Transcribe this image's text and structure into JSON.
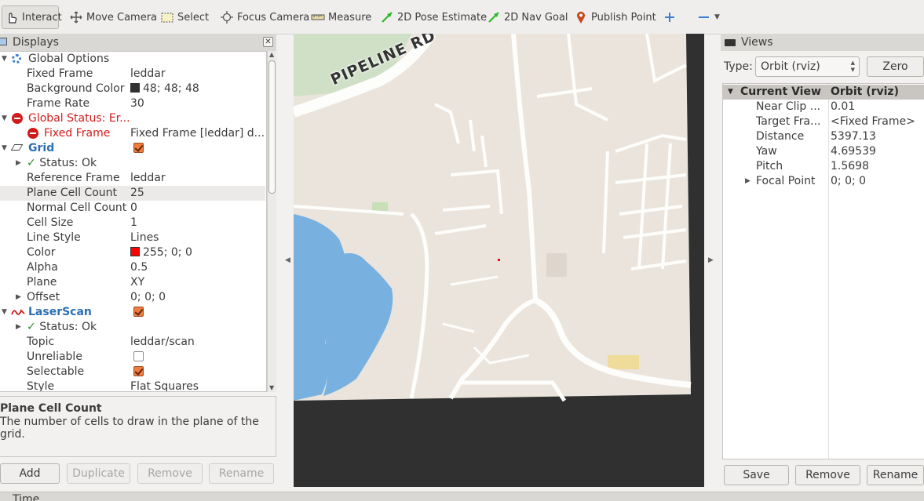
{
  "toolbar": {
    "tools": [
      {
        "id": "interact",
        "label": "Interact",
        "icon": "hand-pointer-icon"
      },
      {
        "id": "move-camera",
        "label": "Move Camera",
        "icon": "move-arrows-icon"
      },
      {
        "id": "select",
        "label": "Select",
        "icon": "dashed-rect-icon"
      },
      {
        "id": "focus-camera",
        "label": "Focus Camera",
        "icon": "crosshair-icon"
      },
      {
        "id": "measure",
        "label": "Measure",
        "icon": "ruler-icon"
      },
      {
        "id": "pose-estimate",
        "label": "2D Pose Estimate",
        "icon": "green-arrow-icon"
      },
      {
        "id": "nav-goal",
        "label": "2D Nav Goal",
        "icon": "green-arrow-icon"
      },
      {
        "id": "publish-point",
        "label": "Publish Point",
        "icon": "map-pin-icon"
      }
    ],
    "add_icon": "plus-icon",
    "remove_icon": "minus-icon"
  },
  "displays": {
    "title": "Displays",
    "rows": [
      {
        "name": "Global Options",
        "value": ""
      },
      {
        "name": "Fixed Frame",
        "value": "leddar"
      },
      {
        "name": "Background Color",
        "value": "48; 48; 48",
        "swatch": "#303030"
      },
      {
        "name": "Frame Rate",
        "value": "30"
      },
      {
        "name": "Global Status: Er...",
        "value": ""
      },
      {
        "name": "Fixed Frame",
        "value": "Fixed Frame [leddar] d..."
      },
      {
        "name": "Grid",
        "value": ""
      },
      {
        "name": "Status: Ok",
        "value": ""
      },
      {
        "name": "Reference Frame",
        "value": "leddar"
      },
      {
        "name": "Plane Cell Count",
        "value": "25"
      },
      {
        "name": "Normal Cell Count",
        "value": "0"
      },
      {
        "name": "Cell Size",
        "value": "1"
      },
      {
        "name": "Line Style",
        "value": "Lines"
      },
      {
        "name": "Color",
        "value": "255; 0; 0",
        "swatch": "#ff0000"
      },
      {
        "name": "Alpha",
        "value": "0.5"
      },
      {
        "name": "Plane",
        "value": "XY"
      },
      {
        "name": "Offset",
        "value": "0; 0; 0"
      },
      {
        "name": "LaserScan",
        "value": ""
      },
      {
        "name": "Status: Ok",
        "value": ""
      },
      {
        "name": "Topic",
        "value": "leddar/scan"
      },
      {
        "name": "Unreliable",
        "value": ""
      },
      {
        "name": "Selectable",
        "value": ""
      },
      {
        "name": "Style",
        "value": "Flat Squares"
      }
    ],
    "description_title": "Plane Cell Count",
    "description_text": "The number of cells to draw in the plane of the grid.",
    "buttons": {
      "add": "Add",
      "duplicate": "Duplicate",
      "remove": "Remove",
      "rename": "Rename"
    }
  },
  "viewport": {
    "map_label": "PIPELINE RD",
    "background": "#303030"
  },
  "views": {
    "title": "Views",
    "type_label": "Type:",
    "type_value": "Orbit (rviz)",
    "zero_button": "Zero",
    "header": {
      "name": "Current View",
      "value": "Orbit (rviz)"
    },
    "rows": [
      {
        "name": "Near Clip ...",
        "value": "0.01"
      },
      {
        "name": "Target Fra...",
        "value": "<Fixed Frame>"
      },
      {
        "name": "Distance",
        "value": "5397.13"
      },
      {
        "name": "Yaw",
        "value": "4.69539"
      },
      {
        "name": "Pitch",
        "value": "1.5698"
      },
      {
        "name": "Focal Point",
        "value": "0; 0; 0"
      }
    ],
    "buttons": {
      "save": "Save",
      "remove": "Remove",
      "rename": "Rename"
    }
  },
  "time": {
    "title": "Time"
  }
}
